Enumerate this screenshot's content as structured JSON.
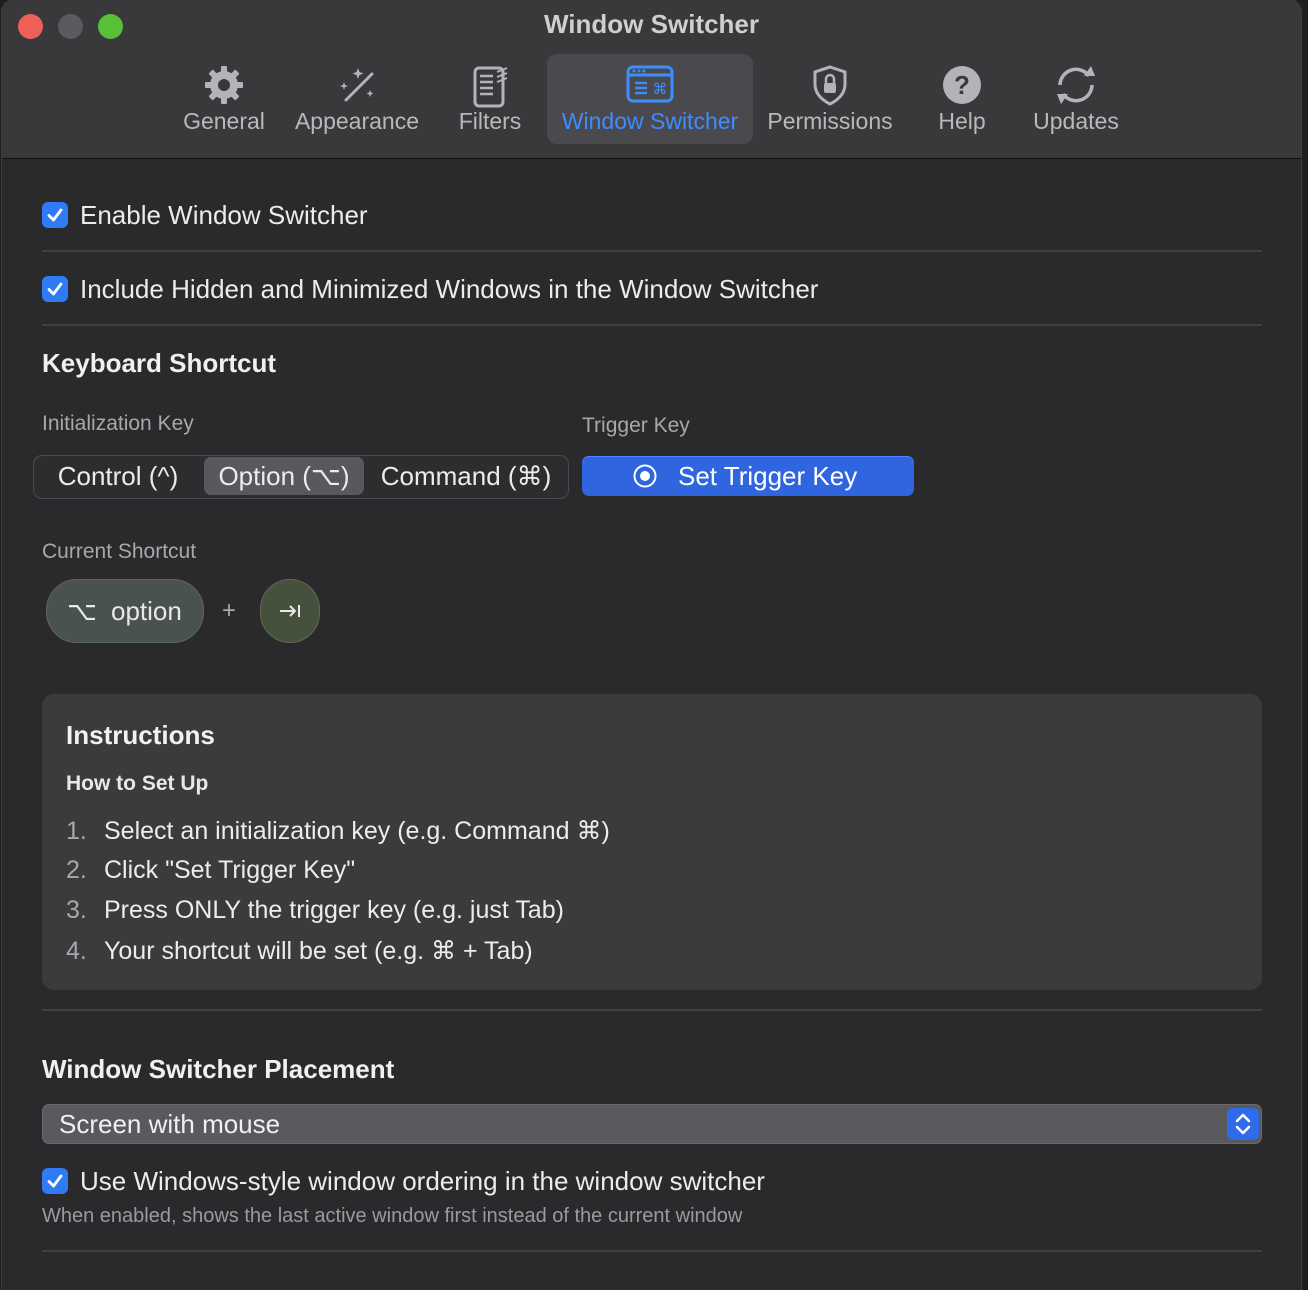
{
  "window": {
    "title": "Window Switcher"
  },
  "tabs": [
    {
      "label": "General",
      "icon": "gear-icon"
    },
    {
      "label": "Appearance",
      "icon": "magic-wand-icon"
    },
    {
      "label": "Filters",
      "icon": "filter-doc-icon"
    },
    {
      "label": "Window Switcher",
      "icon": "window-switcher-icon",
      "active": true
    },
    {
      "label": "Permissions",
      "icon": "lock-shield-icon"
    },
    {
      "label": "Help",
      "icon": "question-icon"
    },
    {
      "label": "Updates",
      "icon": "refresh-icon"
    }
  ],
  "settings": {
    "enable_switcher": {
      "label": "Enable Window Switcher",
      "checked": true
    },
    "include_hidden": {
      "label": "Include Hidden and Minimized Windows in the Window Switcher",
      "checked": true
    }
  },
  "keyboard_shortcut": {
    "heading": "Keyboard Shortcut",
    "init_key_label": "Initialization Key",
    "init_options": [
      "Control (^)",
      "Option (⌥)",
      "Command (⌘)"
    ],
    "init_selected": "Option (⌥)",
    "trigger_key_label": "Trigger Key",
    "set_trigger_button": "Set Trigger Key",
    "current_shortcut_label": "Current Shortcut",
    "current_shortcut": {
      "modifier_glyph": "⌥",
      "modifier_name": "option",
      "plus": "+",
      "key_icon": "tab-key-icon"
    }
  },
  "instructions": {
    "title": "Instructions",
    "subtitle": "How to Set Up",
    "steps": [
      {
        "num": "1.",
        "text": "Select an initialization key (e.g. Command ⌘)"
      },
      {
        "num": "2.",
        "text": "Click \"Set Trigger Key\""
      },
      {
        "num": "3.",
        "text": "Press ONLY the trigger key (e.g. just Tab)"
      },
      {
        "num": "4.",
        "text": "Your shortcut will be set (e.g. ⌘ + Tab)"
      }
    ]
  },
  "placement": {
    "heading": "Window Switcher Placement",
    "selected": "Screen with mouse",
    "windows_ordering": {
      "label": "Use Windows-style window ordering in the window switcher",
      "checked": true
    },
    "hint": "When enabled, shows the last active window first instead of the current window"
  },
  "colors": {
    "accent": "#2f7bf5",
    "active_tab": "#3d8dff",
    "background": "#2a2a2c"
  }
}
